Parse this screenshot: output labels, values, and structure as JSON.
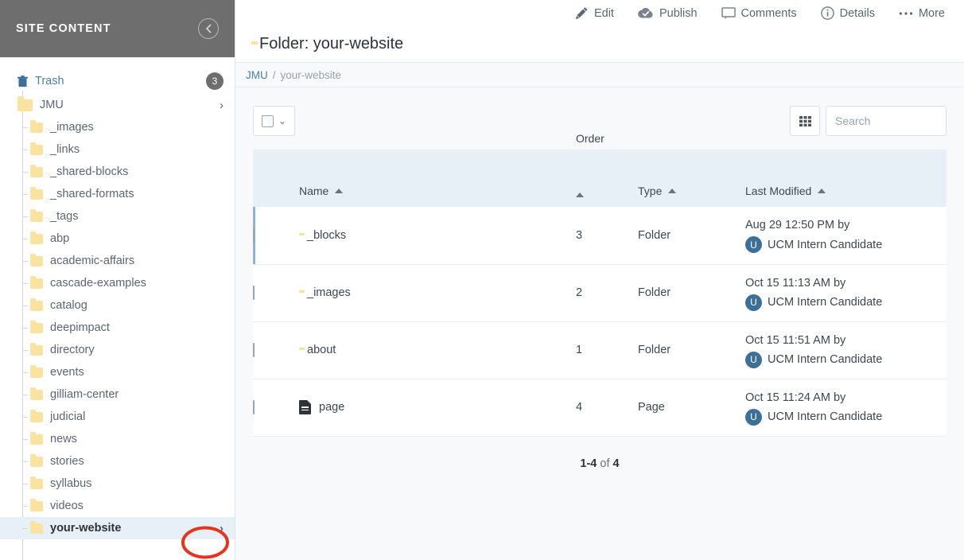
{
  "sidebar": {
    "title": "SITE CONTENT",
    "collapse_icon": "chevron-left-circle-icon",
    "trash": {
      "label": "Trash",
      "icon": "trash-icon",
      "count": "3"
    },
    "root": {
      "label": "JMU",
      "icon": "folder-icon",
      "chevron": "›"
    },
    "items": [
      {
        "label": "_images"
      },
      {
        "label": "_links"
      },
      {
        "label": "_shared-blocks"
      },
      {
        "label": "_shared-formats"
      },
      {
        "label": "_tags"
      },
      {
        "label": "abp"
      },
      {
        "label": "academic-affairs"
      },
      {
        "label": "cascade-examples"
      },
      {
        "label": "catalog"
      },
      {
        "label": "deepimpact"
      },
      {
        "label": "directory"
      },
      {
        "label": "events"
      },
      {
        "label": "gilliam-center"
      },
      {
        "label": "judicial"
      },
      {
        "label": "news"
      },
      {
        "label": "stories"
      },
      {
        "label": "syllabus"
      },
      {
        "label": "videos"
      },
      {
        "label": "your-website",
        "selected": true,
        "chevron": "›"
      }
    ]
  },
  "toolbar": {
    "items": [
      {
        "label": "Edit",
        "icon": "pencil-icon"
      },
      {
        "label": "Publish",
        "icon": "cloud-check-icon"
      },
      {
        "label": "Comments",
        "icon": "comment-bubble-icon"
      },
      {
        "label": "Details",
        "icon": "info-circle-icon"
      },
      {
        "label": "More",
        "icon": "ellipsis-icon"
      }
    ]
  },
  "page": {
    "title": "Folder: your-website",
    "title_icon": "folder-icon",
    "breadcrumb": {
      "root": "JMU",
      "separator": "/",
      "current": "your-website"
    }
  },
  "table_toolbar": {
    "select_all_icon": "checkbox-icon",
    "select_all_caret": "⌄",
    "grid_icon": "grid-view-icon",
    "search_placeholder": "Search",
    "search_value": ""
  },
  "table": {
    "columns": [
      {
        "key": "name",
        "label": "Name",
        "sort": "asc"
      },
      {
        "key": "order",
        "label": "Order",
        "sort": "asc"
      },
      {
        "key": "type",
        "label": "Type",
        "sort": "asc"
      },
      {
        "key": "modified",
        "label": "Last Modified",
        "sort": "asc"
      }
    ],
    "rows": [
      {
        "name": "_blocks",
        "icon": "folder-icon",
        "order": "3",
        "type": "Folder",
        "modified_date": "Aug 29 12:50 PM by",
        "modified_user": "UCM Intern Candidate",
        "avatar_initial": "U",
        "active": true
      },
      {
        "name": "_images",
        "icon": "folder-icon",
        "order": "2",
        "type": "Folder",
        "modified_date": "Oct 15 11:13 AM by",
        "modified_user": "UCM Intern Candidate",
        "avatar_initial": "U",
        "active": false
      },
      {
        "name": "about",
        "icon": "folder-icon",
        "order": "1",
        "type": "Folder",
        "modified_date": "Oct 15 11:51 AM by",
        "modified_user": "UCM Intern Candidate",
        "avatar_initial": "U",
        "active": false
      },
      {
        "name": "page",
        "icon": "page-icon",
        "order": "4",
        "type": "Page",
        "modified_date": "Oct 15 11:24 AM by",
        "modified_user": "UCM Intern Candidate",
        "avatar_initial": "U",
        "active": false
      }
    ]
  },
  "pagination": {
    "range": "1-4",
    "of": "of",
    "total": "4"
  },
  "annotation": {
    "shape": "ellipse",
    "color": "#e8341c"
  },
  "colors": {
    "sidebar_header_bg": "#6e6e6e",
    "folder_yellow": "#fae3a0",
    "accent_blue": "#4a7fa5",
    "table_header_bg": "#e8f0f7",
    "content_bg": "#f7f9fb",
    "avatar_bg": "#3d7098"
  }
}
